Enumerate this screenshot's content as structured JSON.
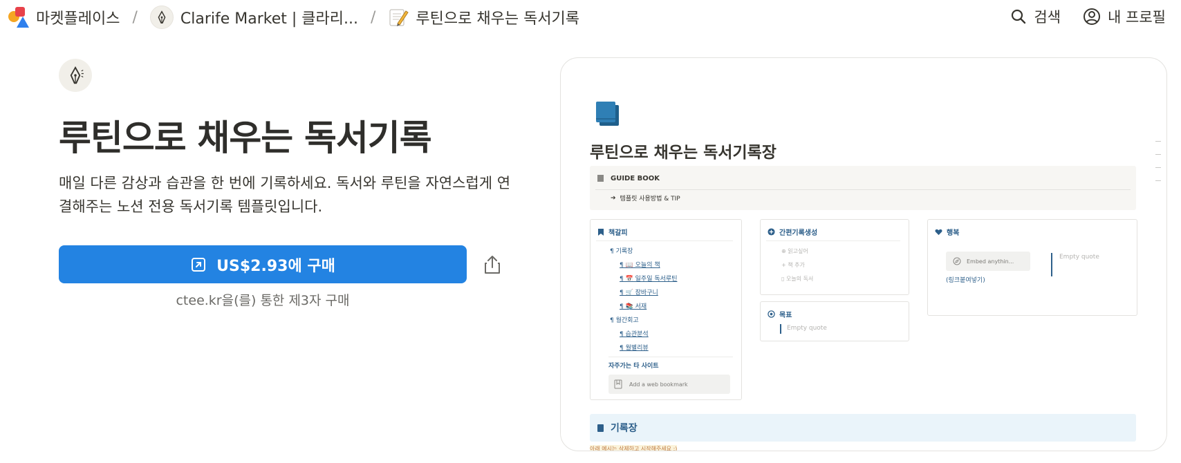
{
  "breadcrumb": {
    "items": [
      {
        "label": "마켓플레이스",
        "icon": "marketplace-logo-icon"
      },
      {
        "label": "Clarife Market | 클라리...",
        "icon": "fountain-pen-avatar-icon"
      },
      {
        "label": "루틴으로 채우는 독서기록",
        "icon": "memo-icon"
      }
    ],
    "separator": "/"
  },
  "topbar": {
    "search_label": "검색",
    "profile_label": "내 프로필"
  },
  "hero": {
    "title": "루틴으로 채우는 독서기록",
    "description": "매일 다른 감상과 습관을 한 번에 기록하세요. 독서와 루틴을 자연스럽게 연결해주는 노션 전용 독서기록 템플릿입니다.",
    "buy_label": "US$2.93에 구매",
    "buy_note": "ctee.kr을(를) 통한 제3자 구매"
  },
  "preview": {
    "title": "루틴으로 채우는 독서기록장",
    "guide": {
      "heading": "GUIDE BOOK",
      "link": "템플릿 사용방법 & TIP"
    },
    "bookmarks": {
      "heading": "책갈피",
      "items": [
        {
          "label": "¶ 기록장",
          "level": 1
        },
        {
          "label": "¶ 📖 오늘의 책",
          "level": 2
        },
        {
          "label": "¶ 📅 일주일 독서루틴",
          "level": 2
        },
        {
          "label": "¶ 🛒 장바구니",
          "level": 2
        },
        {
          "label": "¶ 📚 서재",
          "level": 2
        },
        {
          "label": "¶ 월간회고",
          "level": 1
        },
        {
          "label": "¶ 습관분석",
          "level": 2
        },
        {
          "label": "¶ 월별리뷰",
          "level": 2
        }
      ],
      "sites_heading": "자주가는 타 사이트",
      "bookmark_placeholder": "Add a web bookmark"
    },
    "quick": {
      "heading": "간편기록생성",
      "buttons": [
        "읽고싶어",
        "책 추가",
        "오늘의 독서"
      ]
    },
    "goal": {
      "heading": "목표",
      "quote": "Empty quote"
    },
    "happy": {
      "heading": "행복",
      "embed": "Embed anythin...",
      "embed_caption": "(링크붙여넣기)",
      "quote": "Empty quote"
    },
    "record": {
      "heading": "기록장",
      "note": "아래 예시는 삭제하고 시작해주세요 :)"
    }
  },
  "colors": {
    "accent": "#2383e2",
    "notion_blue": "#2d5f8a",
    "text": "#37352f"
  }
}
